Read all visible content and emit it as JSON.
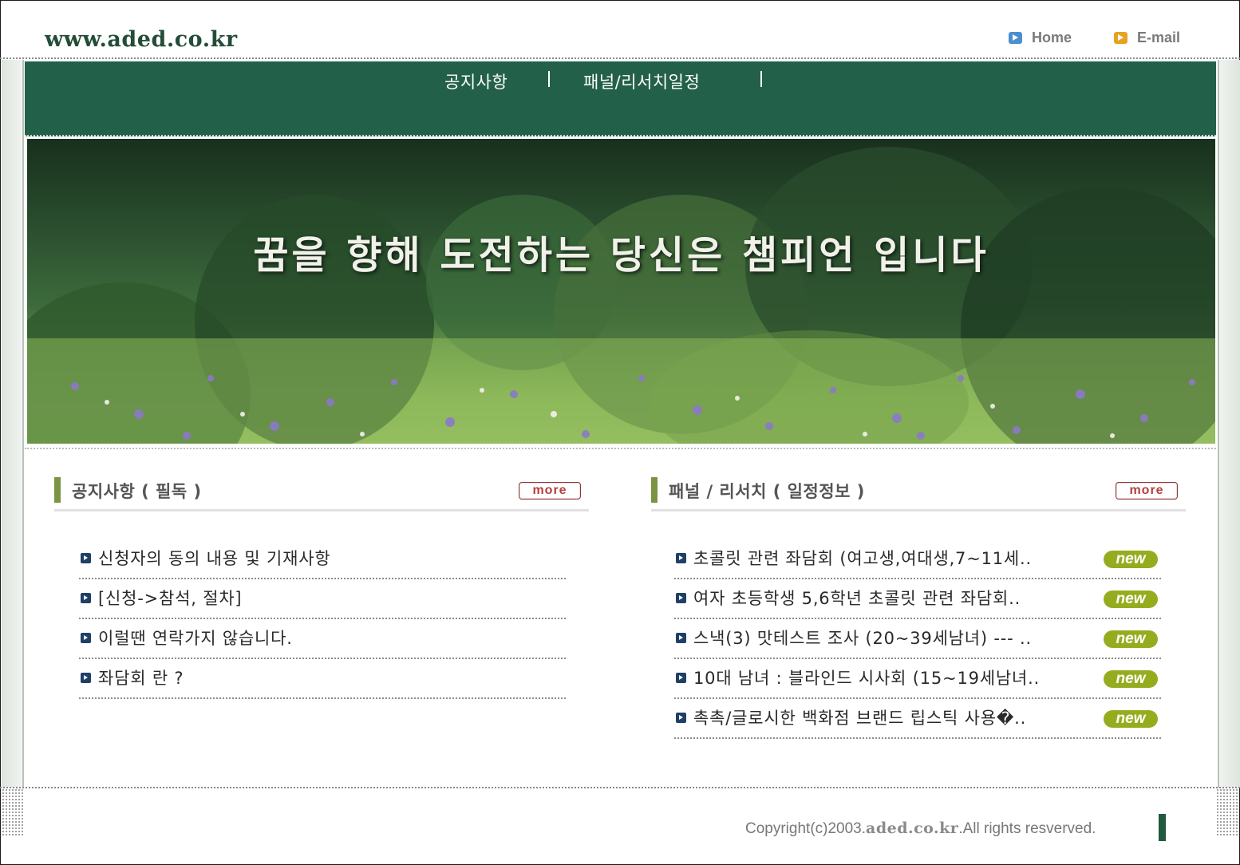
{
  "header": {
    "site_url": "www.aded.co.kr",
    "links": [
      {
        "label": "Home",
        "icon": "home-icon"
      },
      {
        "label": "E-mail",
        "icon": "email-icon"
      }
    ]
  },
  "nav": {
    "items": [
      "공지사항",
      "패널/리서치일정"
    ],
    "separator": "|"
  },
  "hero": {
    "slogan": "꿈을 향해 도전하는 당신은 챔피언 입니다"
  },
  "notice_panel": {
    "title": "공지사항 ( 필독 )",
    "more_label": "more",
    "items": [
      "신청자의 동의 내용 및 기재사항",
      "[신청->참석, 절차]",
      "이럴땐 연락가지 않습니다.",
      "좌담회 란 ?"
    ]
  },
  "schedule_panel": {
    "title": "패널 / 리서치 ( 일정정보 )",
    "more_label": "more",
    "badge_label": "new",
    "items": [
      "초콜릿 관련 좌담회 (여고생,여대생,7~11세..",
      "여자 초등학생 5,6학년 초콜릿 관련 좌담회..",
      "스낵(3) 맛테스트 조사 (20~39세남녀) --- ..",
      "10대 남녀 : 블라인드 시사회 (15~19세남녀..",
      "촉촉/글로시한 백화점 브랜드 립스틱 사용�.."
    ]
  },
  "footer": {
    "copyright_prefix": "Copyright(c)2003.",
    "copyright_domain": "aded.co.kr",
    "copyright_suffix": ".All rights resverved."
  },
  "colors": {
    "nav_bg": "#23604a",
    "accent_bar": "#7a9443",
    "new_badge": "#96ac1f",
    "site_url": "#244d38"
  }
}
